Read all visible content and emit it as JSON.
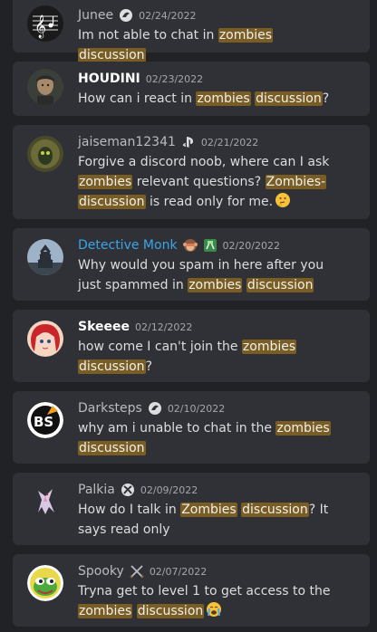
{
  "messages": [
    {
      "username": "Junee",
      "name_style": "muted",
      "badge_icon": "platform-account-icon",
      "date": "02/24/2022",
      "segments": [
        {
          "t": "Im not able to chat in "
        },
        {
          "t": "zombies",
          "hl": true
        },
        {
          "t": " "
        },
        {
          "t": "discussion",
          "hl": true
        }
      ]
    },
    {
      "username": "HOUDINI",
      "name_style": "white",
      "date": "02/23/2022",
      "segments": [
        {
          "t": "How can i react in "
        },
        {
          "t": "zombies",
          "hl": true
        },
        {
          "t": " "
        },
        {
          "t": "discussion",
          "hl": true
        },
        {
          "t": "?"
        }
      ]
    },
    {
      "username": "jaiseman12341",
      "name_style": "muted",
      "badge_icon": "playstation-icon",
      "date": "02/21/2022",
      "segments": [
        {
          "t": "Forgive a discord noob, where can I ask "
        },
        {
          "t": "zombies",
          "hl": true
        },
        {
          "t": " relevant questions? "
        },
        {
          "t": "Zombies-",
          "hl": true
        },
        {
          "t": " "
        },
        {
          "t": "discussion",
          "hl": true
        },
        {
          "t": " is read only for me."
        }
      ],
      "emoji": "thinking-face-emoji"
    },
    {
      "username": "Detective Monk",
      "name_style": "blue",
      "badge_icon": "monkey-emoji-icon",
      "badge2_icon": "money-hand-icon",
      "date": "02/20/2022",
      "segments": [
        {
          "t": "Why would you spam in here after you just spammed in "
        },
        {
          "t": "zombies",
          "hl": true
        },
        {
          "t": " "
        },
        {
          "t": "discussion",
          "hl": true
        }
      ]
    },
    {
      "username": "Skeeee",
      "name_style": "white",
      "date": "02/12/2022",
      "segments": [
        {
          "t": "how come I can't join the "
        },
        {
          "t": "zombies",
          "hl": true
        },
        {
          "t": " "
        },
        {
          "t": "discussion",
          "hl": true
        },
        {
          "t": "?"
        }
      ]
    },
    {
      "username": "Darksteps",
      "name_style": "muted",
      "badge_icon": "platform-account-icon",
      "date": "02/10/2022",
      "segments": [
        {
          "t": "why am i unable to chat in the "
        },
        {
          "t": "zombies",
          "hl": true
        },
        {
          "t": " "
        },
        {
          "t": "discussion",
          "hl": true
        }
      ]
    },
    {
      "username": "Palkia",
      "name_style": "muted",
      "badge_icon": "xbox-icon",
      "date": "02/09/2022",
      "segments": [
        {
          "t": "How do I talk in "
        },
        {
          "t": "Zombies",
          "hl": true
        },
        {
          "t": " "
        },
        {
          "t": "discussion",
          "hl": true
        },
        {
          "t": "? It says read only"
        }
      ]
    },
    {
      "username": "Spooky",
      "name_style": "muted",
      "badge_icon": "crossed-swords-icon",
      "date": "02/07/2022",
      "segments": [
        {
          "t": "Tryna get to level 1 to get access to the "
        },
        {
          "t": "zombies",
          "hl": true
        },
        {
          "t": " "
        },
        {
          "t": "discussion",
          "hl": true
        }
      ],
      "emoji": "crying-face-emoji"
    }
  ],
  "colors": {
    "highlight": "#7a5d23",
    "card": "#2f3136",
    "background": "#202225",
    "username_blue": "#3ba5e8"
  }
}
